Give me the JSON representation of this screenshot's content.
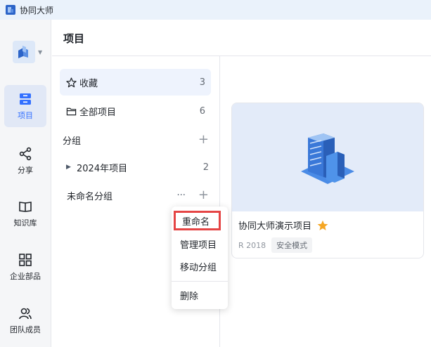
{
  "app": {
    "title": "协同大师",
    "icon": "building-logo-icon"
  },
  "rail": {
    "items": [
      {
        "label": "项目",
        "icon": "project-icon",
        "active": true
      },
      {
        "label": "分享",
        "icon": "share-icon"
      },
      {
        "label": "知识库",
        "icon": "book-icon"
      },
      {
        "label": "企业部品",
        "icon": "grid-icon"
      },
      {
        "label": "团队成员",
        "icon": "team-icon"
      }
    ]
  },
  "panel": {
    "title": "项目",
    "favorites": {
      "label": "收藏",
      "count": "3"
    },
    "all_projects": {
      "label": "全部项目",
      "count": "6"
    },
    "group_header": "分组",
    "groups": [
      {
        "label": "2024年项目",
        "count": "2"
      },
      {
        "label": "未命名分组",
        "more": "···"
      }
    ]
  },
  "card": {
    "name": "协同大师演示项目",
    "version": "R 2018",
    "tag": "安全模式",
    "starred": true
  },
  "context_menu": {
    "items": [
      "重命名",
      "管理项目",
      "移动分组",
      "删除"
    ]
  },
  "colors": {
    "accent": "#3370ff",
    "star": "#f5a623",
    "highlight": "#e54545"
  }
}
